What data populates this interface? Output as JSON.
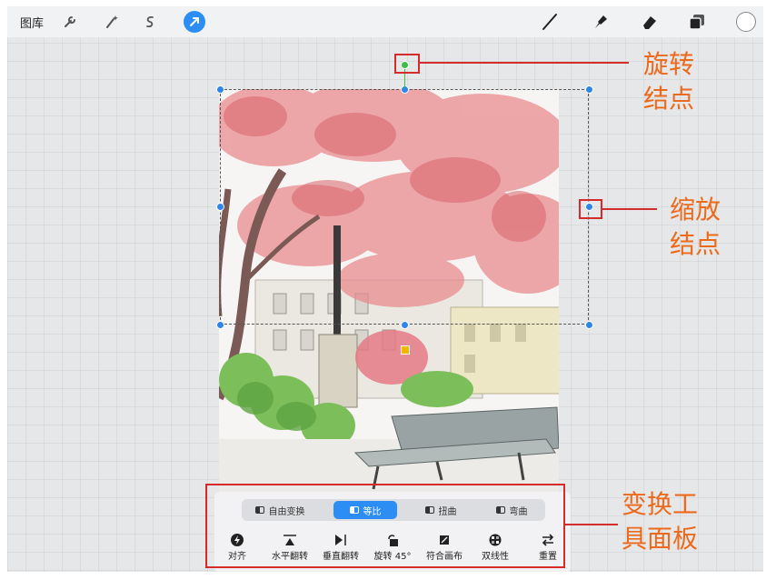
{
  "topbar": {
    "gallery_label": "图库",
    "left_icons": [
      "wrench-icon",
      "magic-wand-icon",
      "selection-s-icon",
      "transform-arrow-icon"
    ],
    "right_icons": [
      "brush-icon",
      "smudge-icon",
      "eraser-icon",
      "layers-icon"
    ],
    "current_color": "#ffffff"
  },
  "callouts": {
    "rotation": "旋转\n结点",
    "scale": "缩放\n结点",
    "panel": "变换工\n具面板"
  },
  "transform_panel": {
    "modes": [
      {
        "label": "自由变换",
        "active": false
      },
      {
        "label": "等比",
        "active": true
      },
      {
        "label": "扭曲",
        "active": false
      },
      {
        "label": "弯曲",
        "active": false
      }
    ],
    "tools": [
      {
        "label": "对齐",
        "icon": "snap-bolt-icon"
      },
      {
        "label": "水平翻转",
        "icon": "flip-horizontal-icon"
      },
      {
        "label": "垂直翻转",
        "icon": "flip-vertical-icon"
      },
      {
        "label": "旋转 45°",
        "icon": "rotate-45-icon"
      },
      {
        "label": "符合画布",
        "icon": "fit-canvas-icon"
      },
      {
        "label": "双线性",
        "icon": "bilinear-icon"
      },
      {
        "label": "重置",
        "icon": "reset-icon"
      }
    ]
  },
  "colors": {
    "accent": "#2c8ef5",
    "callout_red": "#d42b2b",
    "callout_orange": "#ec6a1b"
  }
}
